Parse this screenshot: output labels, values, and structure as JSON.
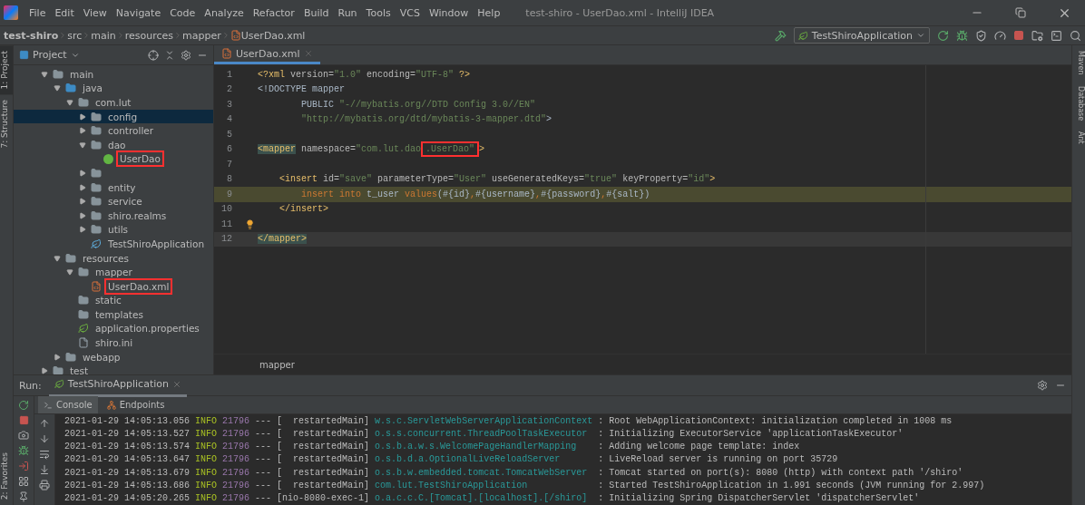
{
  "window": {
    "title": "test-shiro - UserDao.xml - IntelliJ IDEA"
  },
  "menu": [
    "File",
    "Edit",
    "View",
    "Navigate",
    "Code",
    "Analyze",
    "Refactor",
    "Build",
    "Run",
    "Tools",
    "VCS",
    "Window",
    "Help"
  ],
  "breadcrumbs": [
    {
      "label": "test-shiro",
      "kind": "project"
    },
    {
      "label": "src",
      "kind": "folder"
    },
    {
      "label": "main",
      "kind": "folder"
    },
    {
      "label": "resources",
      "kind": "folder"
    },
    {
      "label": "mapper",
      "kind": "folder"
    },
    {
      "label": "UserDao.xml",
      "kind": "xml"
    }
  ],
  "run_config": {
    "label": "TestShiroApplication"
  },
  "left_stripe": [
    {
      "label": "1: Project",
      "selected": true
    },
    {
      "label": "7: Structure",
      "selected": false
    }
  ],
  "left_stripe_bottom": [
    {
      "label": "2: Favorites",
      "selected": false
    }
  ],
  "right_stripe": [
    {
      "label": "Maven"
    },
    {
      "label": "Database"
    },
    {
      "label": "Ant"
    }
  ],
  "project_panel": {
    "title": "Project",
    "tree": [
      {
        "label": "main",
        "kind": "folder",
        "expanded": true,
        "selected": false,
        "marked": false,
        "children": [
          {
            "label": "java",
            "kind": "source-folder",
            "expanded": true,
            "selected": false,
            "marked": false,
            "children": [
              {
                "label": "com.lut",
                "kind": "package",
                "expanded": true,
                "selected": false,
                "marked": false,
                "children": [
                  {
                    "label": "config",
                    "kind": "package",
                    "expanded": false,
                    "selected": true,
                    "marked": false
                  },
                  {
                    "label": "controller",
                    "kind": "package",
                    "expanded": false,
                    "selected": false,
                    "marked": false
                  },
                  {
                    "label": "dao",
                    "kind": "package",
                    "expanded": true,
                    "selected": false,
                    "marked": false,
                    "children": [
                      {
                        "label": "UserDao",
                        "kind": "interface",
                        "selected": false,
                        "marked": true
                      }
                    ]
                  },
                  {
                    "kind": "package",
                    "expanded": false,
                    "selected": false
                  },
                  {
                    "label": "entity",
                    "kind": "package",
                    "expanded": false,
                    "selected": false,
                    "marked": false
                  },
                  {
                    "label": "service",
                    "kind": "package",
                    "expanded": false,
                    "selected": false,
                    "marked": false
                  },
                  {
                    "label": "shiro.realms",
                    "kind": "package",
                    "expanded": false,
                    "selected": false,
                    "marked": false
                  },
                  {
                    "label": "utils",
                    "kind": "package",
                    "expanded": false,
                    "selected": false,
                    "marked": false
                  },
                  {
                    "label": "TestShiroApplication",
                    "kind": "spring-class",
                    "selected": false,
                    "marked": false
                  }
                ]
              }
            ]
          },
          {
            "label": "resources",
            "kind": "resource-folder",
            "expanded": true,
            "selected": false,
            "marked": false,
            "children": [
              {
                "label": "mapper",
                "kind": "folder",
                "expanded": true,
                "selected": false,
                "marked": false,
                "children": [
                  {
                    "label": "UserDao.xml",
                    "kind": "xml",
                    "selected": false,
                    "marked": true
                  }
                ]
              },
              {
                "label": "static",
                "kind": "folder",
                "selected": false,
                "marked": false
              },
              {
                "label": "templates",
                "kind": "folder",
                "selected": false,
                "marked": false
              },
              {
                "label": "application.properties",
                "kind": "spring-file",
                "selected": false,
                "marked": false
              },
              {
                "label": "shiro.ini",
                "kind": "file",
                "selected": false,
                "marked": false
              }
            ]
          },
          {
            "label": "webapp",
            "kind": "folder",
            "expanded": false,
            "selected": false,
            "marked": false
          }
        ]
      },
      {
        "label": "test",
        "kind": "folder",
        "expanded": false,
        "selected": false,
        "marked": false
      }
    ]
  },
  "editor": {
    "tabs": [
      {
        "label": "UserDao.xml",
        "selected": true
      }
    ],
    "lines": [
      {
        "number": "1",
        "tokens": [
          {
            "kind": "tag",
            "text": "<?xml"
          },
          {
            "kind": "attr",
            "text": " version="
          },
          {
            "kind": "str",
            "text": "\"1.0\""
          },
          {
            "kind": "attr",
            "text": " encoding="
          },
          {
            "kind": "str",
            "text": "\"UTF-8\""
          },
          {
            "kind": "tag",
            "text": " ?>"
          }
        ]
      },
      {
        "number": "2",
        "tokens": [
          {
            "kind": "text",
            "text": "<!DOCTYPE mapper"
          }
        ]
      },
      {
        "number": "3",
        "tokens": [
          {
            "kind": "text",
            "text": "        PUBLIC "
          },
          {
            "kind": "str",
            "text": "\"-//mybatis.org//DTD Config 3.0//EN\""
          }
        ]
      },
      {
        "number": "4",
        "tokens": [
          {
            "kind": "str",
            "text": "        \"http://mybatis.org/dtd/mybatis-3-mapper.dtd\""
          },
          {
            "kind": "text",
            "text": ">"
          }
        ]
      },
      {
        "number": "5"
      },
      {
        "number": "6",
        "tokens": [
          {
            "kind": "tag-matched",
            "text": "<mapper"
          },
          {
            "kind": "attr",
            "text": " namespace="
          },
          {
            "kind": "str",
            "text": "\"com.lut.dao"
          },
          {
            "kind": "str",
            "text": ".UserDao\"",
            "marked": true
          },
          {
            "kind": "tag",
            "text": ">"
          }
        ]
      },
      {
        "number": "7"
      },
      {
        "number": "8",
        "tokens": [
          {
            "kind": "tag",
            "text": "    <insert"
          },
          {
            "kind": "attr",
            "text": " id="
          },
          {
            "kind": "str",
            "text": "\"save\""
          },
          {
            "kind": "attr",
            "text": " parameterType="
          },
          {
            "kind": "str",
            "text": "\"User\""
          },
          {
            "kind": "attr",
            "text": " useGeneratedKeys="
          },
          {
            "kind": "str",
            "text": "\"true\""
          },
          {
            "kind": "attr",
            "text": " keyProperty="
          },
          {
            "kind": "str",
            "text": "\"id\""
          },
          {
            "kind": "tag",
            "text": ">"
          }
        ]
      },
      {
        "number": "9",
        "injected": true,
        "tokens": [
          {
            "kind": "kw",
            "text": "        insert into"
          },
          {
            "kind": "text",
            "text": " t_user "
          },
          {
            "kind": "kw",
            "text": "values"
          },
          {
            "kind": "text",
            "text": "(#{id}"
          },
          {
            "kind": "kw",
            "text": ","
          },
          {
            "kind": "text",
            "text": "#{username}"
          },
          {
            "kind": "kw",
            "text": ","
          },
          {
            "kind": "text",
            "text": "#{password}"
          },
          {
            "kind": "kw",
            "text": ","
          },
          {
            "kind": "text",
            "text": "#{salt})"
          }
        ]
      },
      {
        "number": "10",
        "tokens": [
          {
            "kind": "tag",
            "text": "    </insert>"
          }
        ]
      },
      {
        "number": "11",
        "bulb": true
      },
      {
        "number": "12",
        "current": true,
        "tokens": [
          {
            "kind": "tag-matched",
            "text": "</mapper>"
          }
        ]
      }
    ],
    "footer": "mapper"
  },
  "run_panel": {
    "label": "Run:",
    "tabs": [
      {
        "label": "TestShiroApplication",
        "selected": true
      }
    ],
    "subtabs": [
      {
        "label": "Console",
        "selected": true
      },
      {
        "label": "Endpoints",
        "selected": false
      }
    ],
    "log": [
      {
        "time": "2021-01-29 14:05:13.056",
        "level": "INFO",
        "pid": "21796",
        "sep": "---",
        "thread": "[  restartedMain]",
        "logger": "w.s.c.ServletWebServerApplicationContext",
        "message": ": Root WebApplicationContext: initialization completed in 1008 ms"
      },
      {
        "time": "2021-01-29 14:05:13.527",
        "level": "INFO",
        "pid": "21796",
        "sep": "---",
        "thread": "[  restartedMain]",
        "logger": "o.s.s.concurrent.ThreadPoolTaskExecutor",
        "message": ": Initializing ExecutorService 'applicationTaskExecutor'"
      },
      {
        "time": "2021-01-29 14:05:13.574",
        "level": "INFO",
        "pid": "21796",
        "sep": "---",
        "thread": "[  restartedMain]",
        "logger": "o.s.b.a.w.s.WelcomePageHandlerMapping",
        "message": ": Adding welcome page template: index"
      },
      {
        "time": "2021-01-29 14:05:13.647",
        "level": "INFO",
        "pid": "21796",
        "sep": "---",
        "thread": "[  restartedMain]",
        "logger": "o.s.b.d.a.OptionalLiveReloadServer",
        "message": ": LiveReload server is running on port 35729"
      },
      {
        "time": "2021-01-29 14:05:13.679",
        "level": "INFO",
        "pid": "21796",
        "sep": "---",
        "thread": "[  restartedMain]",
        "logger": "o.s.b.w.embedded.tomcat.TomcatWebServer",
        "message": ": Tomcat started on port(s): 8080 (http) with context path '/shiro'"
      },
      {
        "time": "2021-01-29 14:05:13.686",
        "level": "INFO",
        "pid": "21796",
        "sep": "---",
        "thread": "[  restartedMain]",
        "logger": "com.lut.TestShiroApplication",
        "message": ": Started TestShiroApplication in 1.991 seconds (JVM running for 2.997)"
      },
      {
        "time": "2021-01-29 14:05:20.265",
        "level": "INFO",
        "pid": "21796",
        "sep": "---",
        "thread": "[nio-8080-exec-1]",
        "logger": "o.a.c.c.C.[Tomcat].[localhost].[/shiro]",
        "message": ": Initializing Spring DispatcherServlet 'dispatcherServlet'"
      }
    ]
  }
}
